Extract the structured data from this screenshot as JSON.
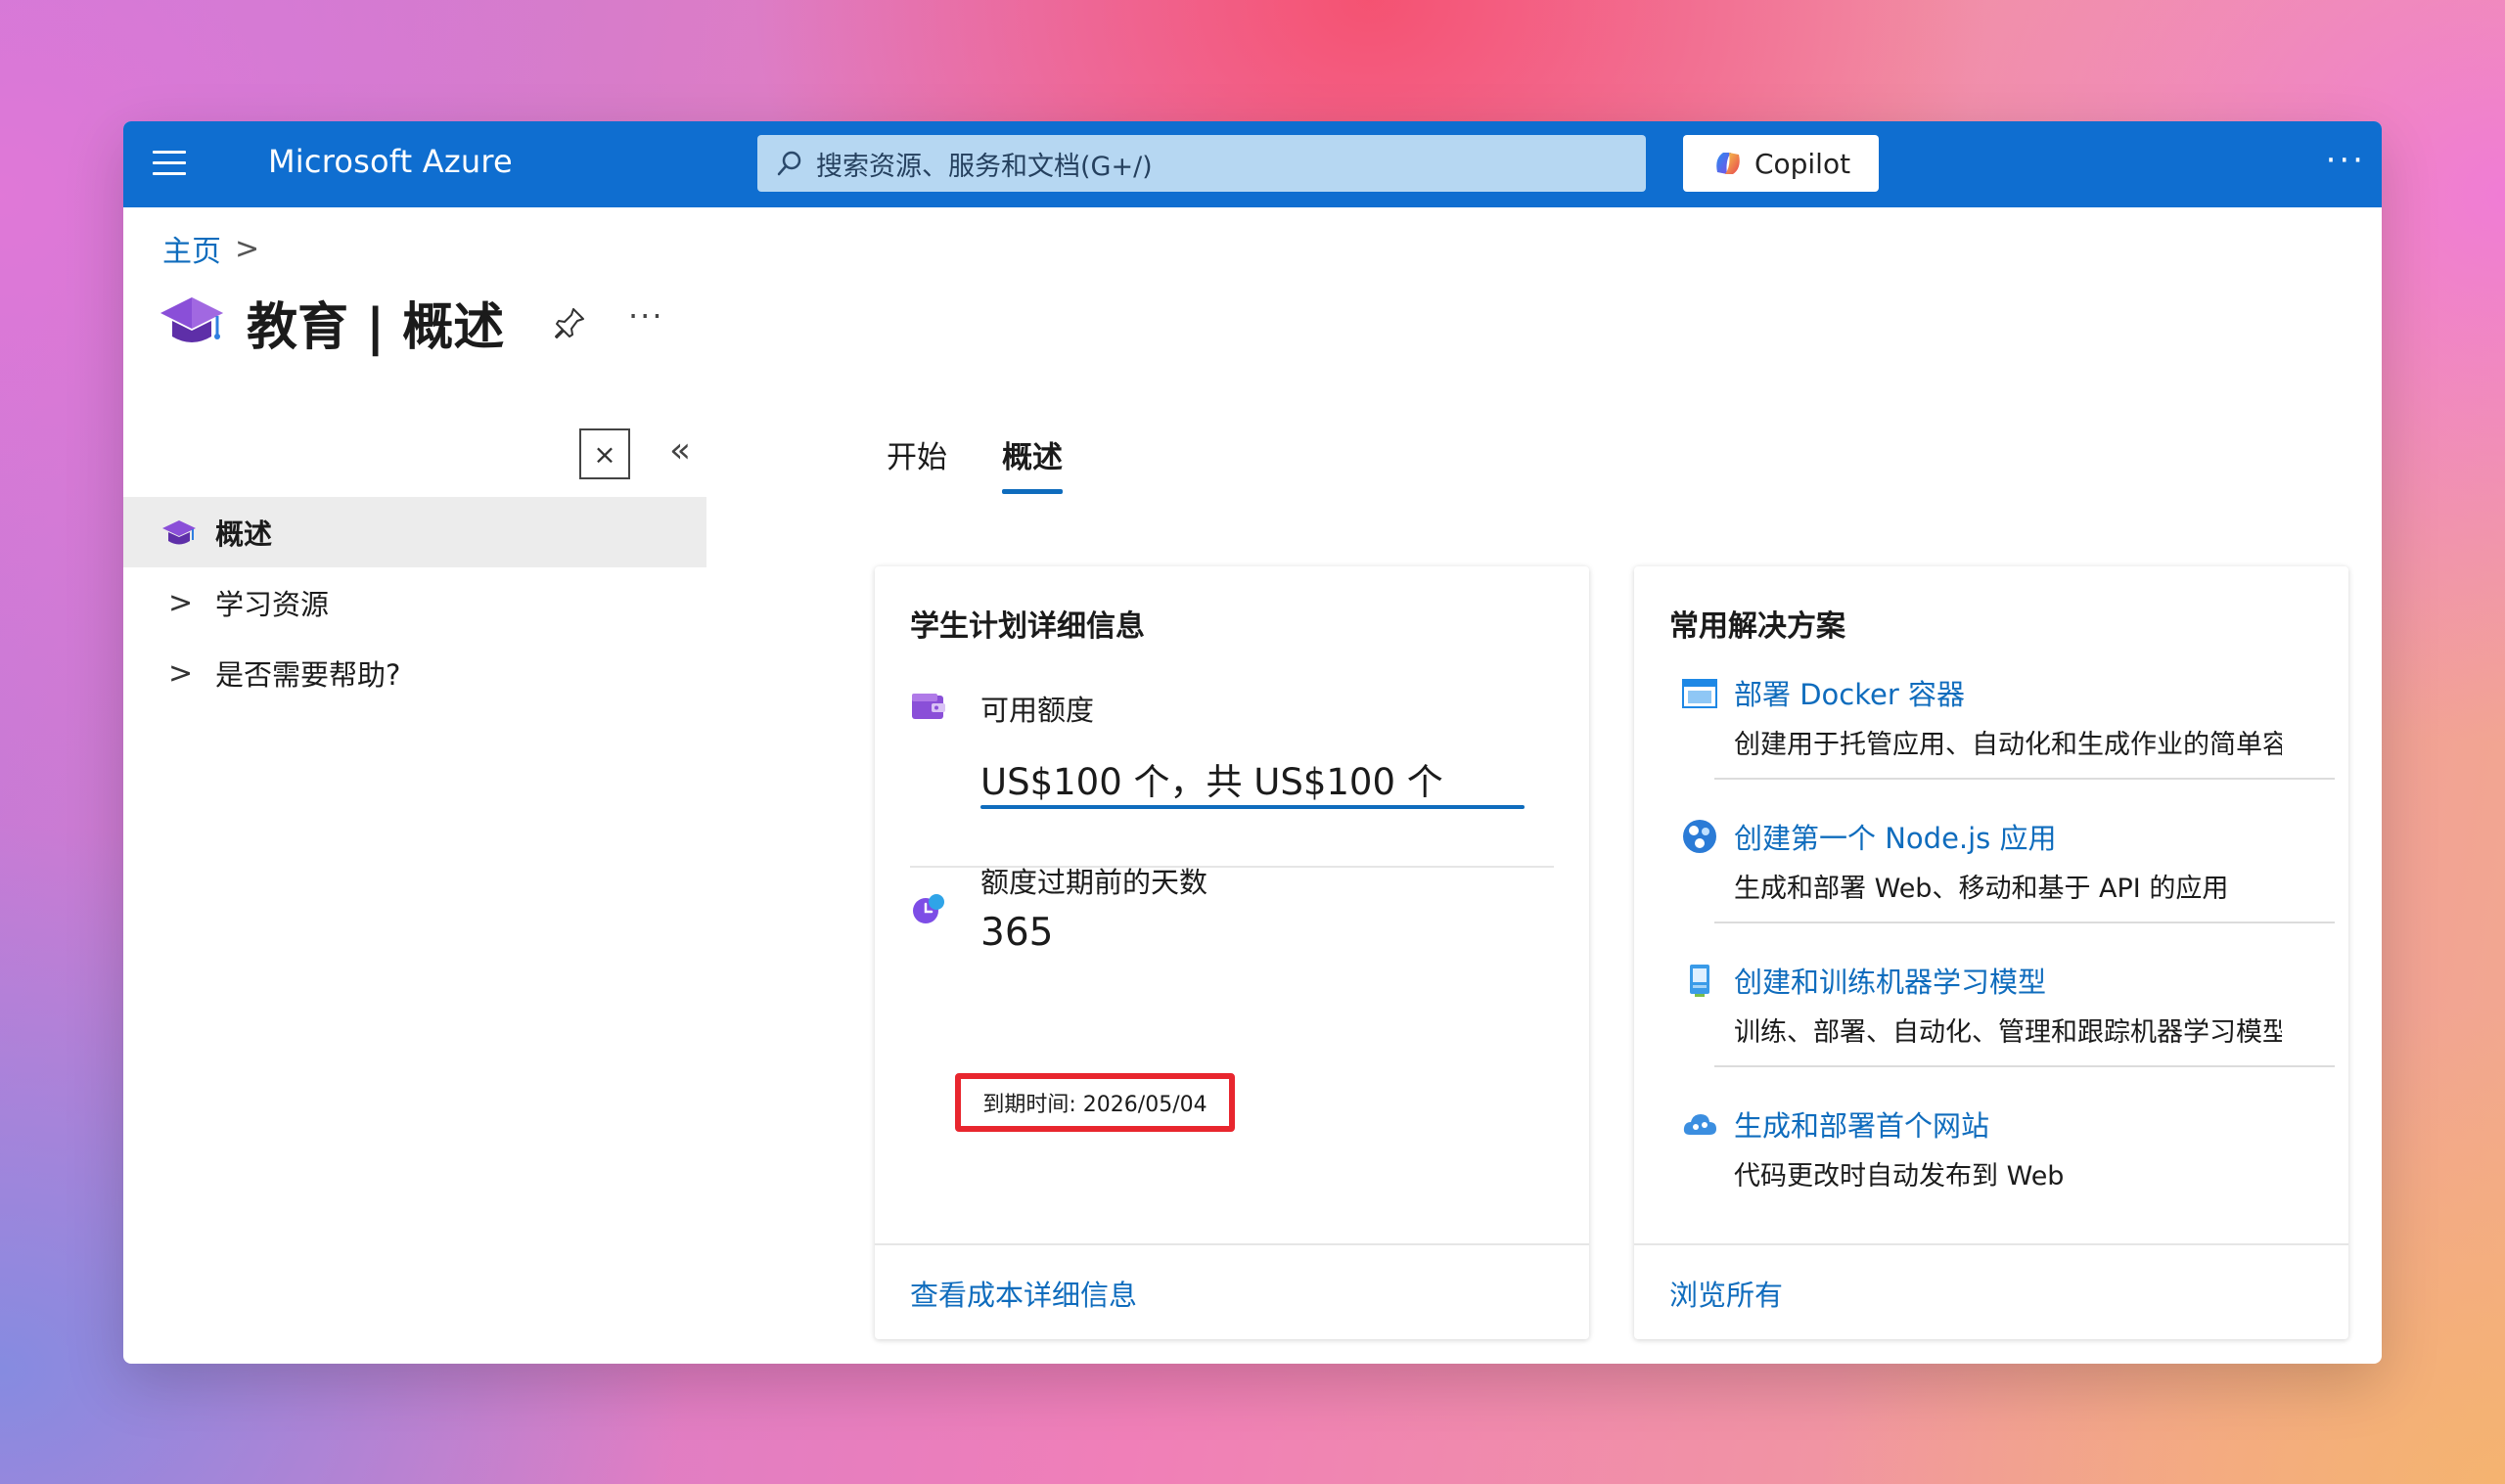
{
  "topbar": {
    "brand": "Microsoft Azure",
    "search_placeholder": "搜索资源、服务和文档(G+/)",
    "copilot_label": "Copilot",
    "more": "···"
  },
  "breadcrumb": {
    "home": "主页",
    "chevron": ">"
  },
  "page": {
    "title": "教育 | 概述",
    "more": "···"
  },
  "sidebar": {
    "close_glyph": "×",
    "collapse_glyph": "«",
    "items": [
      {
        "label": "概述",
        "active": true
      },
      {
        "label": "学习资源",
        "chevron": ">"
      },
      {
        "label": "是否需要帮助?",
        "chevron": ">"
      }
    ]
  },
  "tabs": [
    {
      "label": "开始",
      "active": false
    },
    {
      "label": "概述",
      "active": true
    }
  ],
  "student_plan": {
    "title": "学生计划详细信息",
    "credit_label": "可用额度",
    "credit_value": "US$100 个，共 US$100 个",
    "credit_used_fraction": 1.0,
    "days_label": "额度过期前的天数",
    "days_value": "365",
    "expiry": "到期时间: 2026/05/04",
    "footer_link": "查看成本详细信息"
  },
  "solutions": {
    "title": "常用解决方案",
    "items": [
      {
        "title": "部署 Docker 容器",
        "desc": "创建用于托管应用、自动化和生成作业的简单容器",
        "icon": "container-icon"
      },
      {
        "title": "创建第一个 Node.js 应用",
        "desc": "生成和部署 Web、移动和基于 API 的应用",
        "icon": "nodejs-icon"
      },
      {
        "title": "创建和训练机器学习模型",
        "desc": "训练、部署、自动化、管理和跟踪机器学习模型",
        "icon": "ml-notebook-icon"
      },
      {
        "title": "生成和部署首个网站",
        "desc": "代码更改时自动发布到 Web",
        "icon": "cloud-website-icon"
      }
    ],
    "footer_link": "浏览所有"
  },
  "colors": {
    "topbar": "#0f6ed0",
    "link": "#0f6cbd",
    "highlight_box": "#e8262e",
    "search_bg": "#b6d7f2"
  }
}
